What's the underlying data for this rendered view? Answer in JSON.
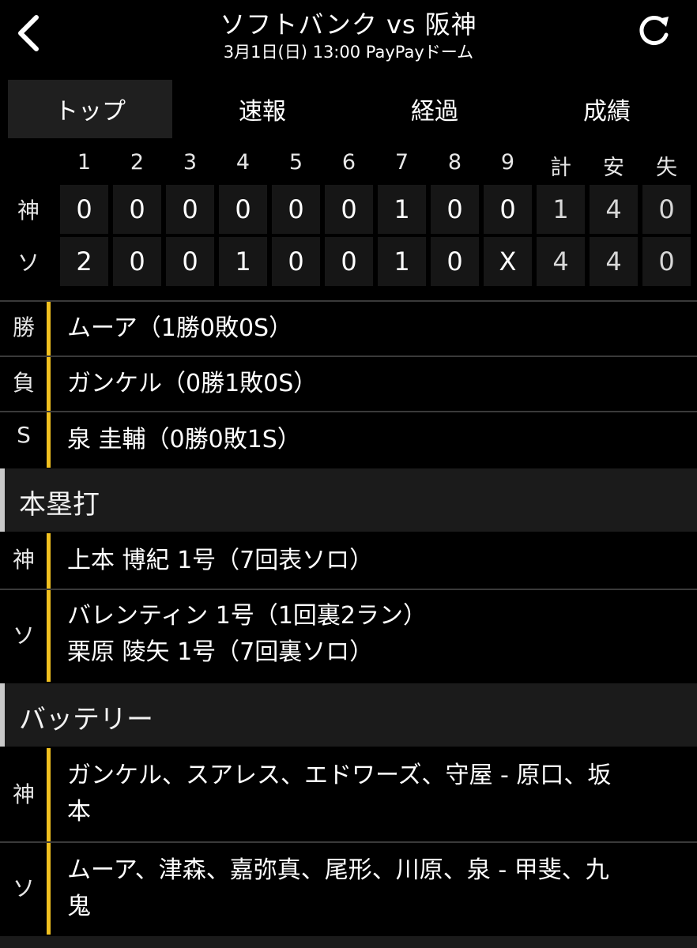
{
  "header": {
    "title": "ソフトバンク vs 阪神",
    "subtitle": "3月1日(日) 13:00 PayPayドーム"
  },
  "tabs": [
    {
      "label": "トップ"
    },
    {
      "label": "速報"
    },
    {
      "label": "経過"
    },
    {
      "label": "成績"
    }
  ],
  "scoreboard": {
    "headers": [
      "1",
      "2",
      "3",
      "4",
      "5",
      "6",
      "7",
      "8",
      "9",
      "計",
      "安",
      "失"
    ],
    "teams": [
      {
        "label": "神",
        "scores": [
          "0",
          "0",
          "0",
          "0",
          "0",
          "0",
          "1",
          "0",
          "0",
          "1",
          "4",
          "0"
        ]
      },
      {
        "label": "ソ",
        "scores": [
          "2",
          "0",
          "0",
          "1",
          "0",
          "0",
          "1",
          "0",
          "X",
          "4",
          "4",
          "0"
        ]
      }
    ]
  },
  "pitchers": [
    {
      "label": "勝",
      "text": "ムーア（1勝0敗0S）"
    },
    {
      "label": "負",
      "text": "ガンケル（0勝1敗0S）"
    },
    {
      "label": "S",
      "text": "泉 圭輔（0勝0敗1S）"
    }
  ],
  "homeruns": {
    "title": "本塁打",
    "rows": [
      {
        "label": "神",
        "lines": [
          "上本 博紀 1号（7回表ソロ）"
        ]
      },
      {
        "label": "ソ",
        "lines": [
          "バレンティン 1号（1回裏2ラン）",
          "栗原 陵矢 1号（7回裏ソロ）"
        ]
      }
    ]
  },
  "battery": {
    "title": "バッテリー",
    "rows": [
      {
        "label": "神",
        "lines": [
          "ガンケル、スアレス、エドワーズ、守屋 - 原口、坂",
          "本"
        ]
      },
      {
        "label": "ソ",
        "lines": [
          "ムーア、津森、嘉弥真、尾形、川原、泉 - 甲斐、九",
          "鬼"
        ]
      }
    ]
  },
  "colors": {
    "accent": "#f0c020",
    "background": "#000000"
  },
  "icons": {
    "back": "chevron-left-icon",
    "refresh": "refresh-icon"
  }
}
